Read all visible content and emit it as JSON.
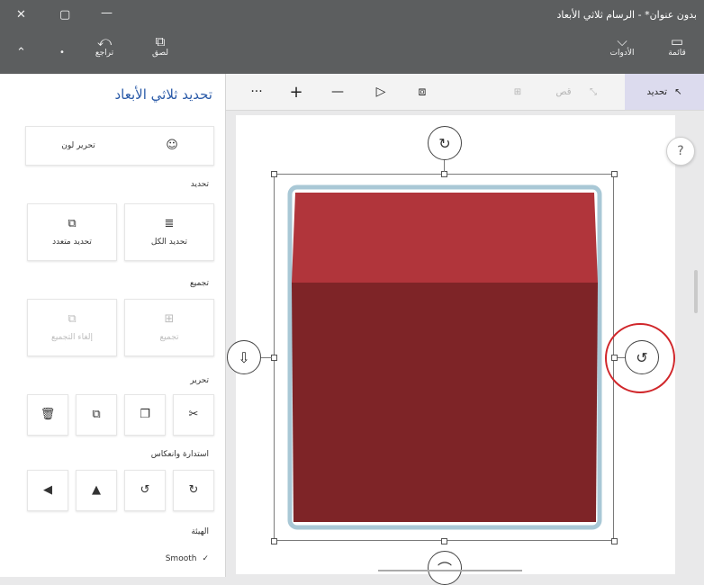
{
  "app": {
    "title": "بدون عنوان* - الرسام ثلاثي الأبعاد",
    "ribbon": {
      "undo_label": "تراجع",
      "paste_label": "لصق",
      "tools_label": "الأدوات",
      "canvas_label": "قائمة"
    }
  },
  "toolbar": {
    "select_label": "تحديد",
    "dim1_label": "قص",
    "more_label": "···",
    "plus_label": "+",
    "minus_label": "—"
  },
  "panel": {
    "title": "تحديد ثلاثي الأبعاد",
    "edit_color_label": "تحرير لون",
    "sections": {
      "select": "تحديد",
      "group": "تجميع",
      "edit": "تحرير",
      "rotate_flip": "استدارة وانعكاس",
      "shape": "الهيئة"
    },
    "select_all_label": "تحديد الكل",
    "multi_select_label": "تحديد متعدد",
    "group_label": "تجميع",
    "ungroup_label": "إلغاء التجميع",
    "smooth_label": "Smooth",
    "smooth_check": "✓"
  },
  "canvas": {
    "help_label": "?"
  },
  "colors": {
    "cube_front": "#7e2427",
    "cube_top": "#b1353b",
    "cube_outline": "#a9c8d6",
    "highlight": "#d0262a",
    "select_tool_bg": "#dcdbee"
  },
  "icons": [
    "close-icon",
    "restore-icon",
    "minimize-icon",
    "collapse-icon",
    "dropdown-icon",
    "undo-icon",
    "paste-icon",
    "tools-icon",
    "canvas-icon",
    "cursor-icon",
    "palette-icon",
    "select-all-icon",
    "multi-select-icon",
    "group-icon",
    "ungroup-icon",
    "delete-icon",
    "paste-icon",
    "copy-icon",
    "cut-icon",
    "rotate-left-icon",
    "rotate-right-icon",
    "flip-horizontal-icon",
    "flip-vertical-icon",
    "rotate-handle-icon",
    "depth-handle-icon",
    "help-icon",
    "check-icon"
  ]
}
